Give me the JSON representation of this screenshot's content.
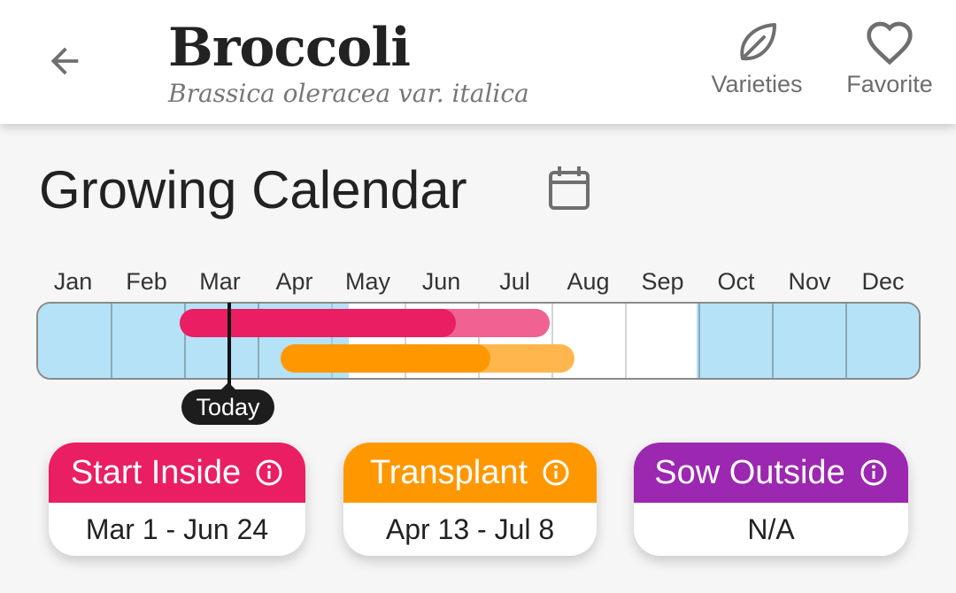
{
  "header": {
    "title": "Broccoli",
    "subtitle": "Brassica oleracea var. italica",
    "actions": [
      {
        "label": "Varieties",
        "icon": "leaf-icon"
      },
      {
        "label": "Favorite",
        "icon": "heart-icon"
      }
    ]
  },
  "calendar": {
    "title": "Growing Calendar",
    "icon": "calendar-icon",
    "months": [
      "Jan",
      "Feb",
      "Mar",
      "Apr",
      "May",
      "Jun",
      "Jul",
      "Aug",
      "Sep",
      "Oct",
      "Nov",
      "Dec"
    ],
    "today_label": "Today",
    "colors": {
      "season": "#b5e2f7",
      "start_inside": "#e91e63",
      "start_inside_light": "#f06292",
      "transplant": "#ff9800",
      "transplant_light": "#ffb74d",
      "sow_outside": "#9c27b0"
    }
  },
  "cards": [
    {
      "label": "Start Inside",
      "value": "Mar 1 - Jun 24",
      "color": "#e91e63",
      "icon": "info-icon"
    },
    {
      "label": "Transplant",
      "value": "Apr 13 - Jul 8",
      "color": "#ff9800",
      "icon": "info-icon"
    },
    {
      "label": "Sow Outside",
      "value": "N/A",
      "color": "#9c27b0",
      "icon": "info-icon"
    }
  ]
}
